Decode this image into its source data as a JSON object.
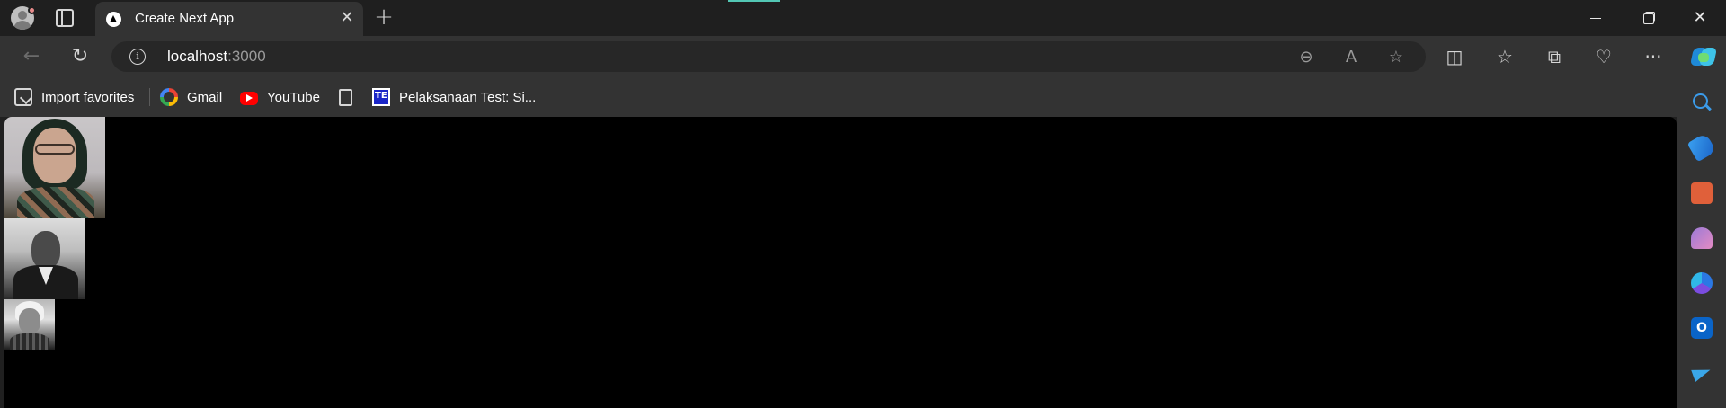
{
  "window": {
    "tab_title": "Create Next App",
    "tab_close_glyph": "✕",
    "new_tab_glyph": "+",
    "controls": {
      "minimize": "minimize",
      "restore": "restore",
      "close_glyph": "✕"
    }
  },
  "toolbar": {
    "back_glyph": "←",
    "reload_glyph": "↻",
    "url_host": "localhost",
    "url_port": ":3000",
    "info_glyph": "i",
    "zoom_glyph": "⊖",
    "read_aloud_glyph": "A",
    "favorite_glyph": "☆",
    "split_glyph": "◫",
    "favorites_glyph": "☆",
    "collections_glyph": "⧉",
    "health_glyph": "♡",
    "more_glyph": "···"
  },
  "bookmarks": [
    {
      "label": "Import favorites",
      "icon": "import-icon"
    },
    {
      "label": "Gmail",
      "icon": "google-icon"
    },
    {
      "label": "YouTube",
      "icon": "youtube-icon"
    },
    {
      "label": "",
      "icon": "document-icon"
    },
    {
      "label": "Pelaksanaan Test: Si...",
      "icon": "te-icon"
    }
  ],
  "sidebar": {
    "items": [
      {
        "name": "search",
        "icon": "search-icon"
      },
      {
        "name": "shopping",
        "icon": "tag-icon"
      },
      {
        "name": "tools",
        "icon": "toolbox-icon"
      },
      {
        "name": "games",
        "icon": "chess-icon"
      },
      {
        "name": "microsoft-365",
        "icon": "m365-icon"
      },
      {
        "name": "outlook",
        "icon": "outlook-icon",
        "glyph": "O"
      },
      {
        "name": "drop",
        "icon": "send-icon"
      }
    ]
  },
  "content": {
    "background": "#000000",
    "images": [
      {
        "alt": "portrait-1"
      },
      {
        "alt": "portrait-2"
      },
      {
        "alt": "portrait-3"
      }
    ]
  },
  "colors": {
    "tabbar_bg": "#1f1f1f",
    "toolbar_bg": "#333333",
    "omnibox_bg": "#272727",
    "accent": "#53c7b4"
  }
}
